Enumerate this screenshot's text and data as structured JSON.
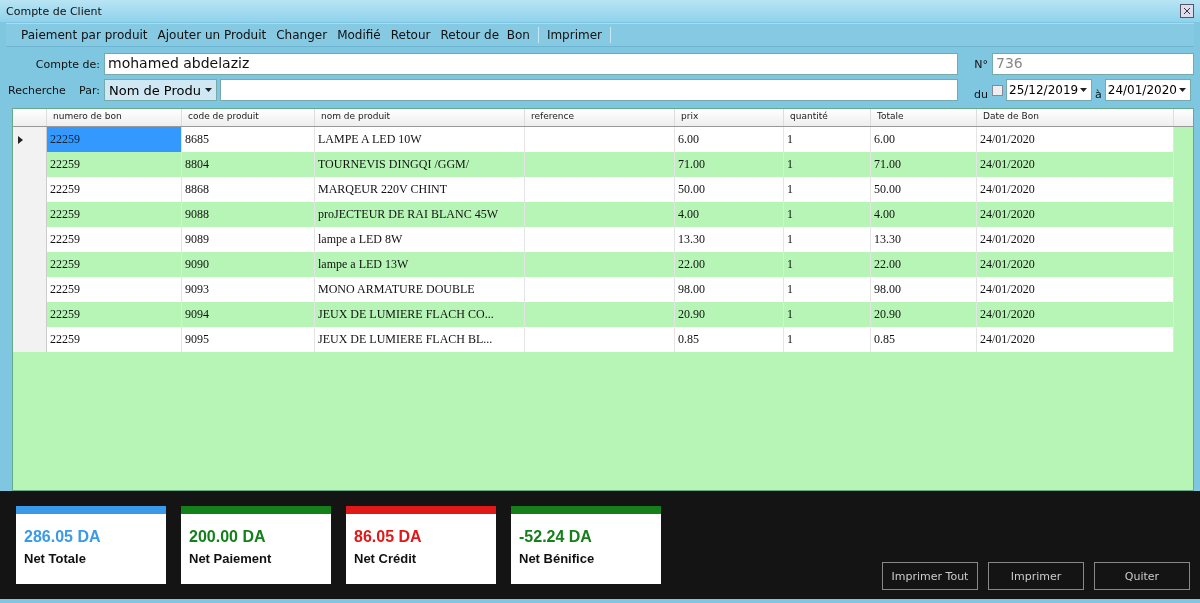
{
  "window": {
    "title": "Compte de Client"
  },
  "toolbar": {
    "items": [
      {
        "kind": "button",
        "label": "Paiement par produit"
      },
      {
        "kind": "button",
        "label": "Ajouter un Produit"
      },
      {
        "kind": "button",
        "label": "Changer"
      },
      {
        "kind": "button",
        "label": "Modifié"
      },
      {
        "kind": "button",
        "label": "Retour"
      },
      {
        "kind": "button",
        "label": "Retour de  Bon"
      },
      {
        "kind": "separator"
      },
      {
        "kind": "button",
        "label": "Imprimer"
      },
      {
        "kind": "separator"
      }
    ]
  },
  "form": {
    "compte_label": "Compte de:",
    "compte_value": "mohamed abdelaziz",
    "no_label": "N°",
    "no_value": "736",
    "recherche_label": "Recherche",
    "par_label": "Par:",
    "par_value": "Nom de Produ",
    "du_label": "du",
    "du_checked": false,
    "du_value": "25/12/2019",
    "a_label": "à",
    "a_value": "24/01/2020"
  },
  "table": {
    "columns": [
      "numero de bon",
      "code de produit",
      "nom de produit",
      "reference",
      "prix",
      "quantité",
      "Totale",
      "Date de Bon"
    ],
    "rows": [
      {
        "selected": true,
        "cells": [
          "22259",
          "8685",
          "LAMPE A LED 10W",
          "",
          "6.00",
          "1",
          "6.00",
          "24/01/2020"
        ]
      },
      {
        "selected": false,
        "cells": [
          "22259",
          "8804",
          "TOURNEVIS DINGQI /GGM/",
          "",
          "71.00",
          "1",
          "71.00",
          "24/01/2020"
        ]
      },
      {
        "selected": false,
        "cells": [
          "22259",
          "8868",
          "MARQEUR 220V CHINT",
          "",
          "50.00",
          "1",
          "50.00",
          "24/01/2020"
        ]
      },
      {
        "selected": false,
        "cells": [
          "22259",
          "9088",
          "proJECTEUR DE RAI BLANC 45W",
          "",
          "4.00",
          "1",
          "4.00",
          "24/01/2020"
        ]
      },
      {
        "selected": false,
        "cells": [
          "22259",
          "9089",
          "lampe a LED 8W",
          "",
          "13.30",
          "1",
          "13.30",
          "24/01/2020"
        ]
      },
      {
        "selected": false,
        "cells": [
          "22259",
          "9090",
          "lampe a LED 13W",
          "",
          "22.00",
          "1",
          "22.00",
          "24/01/2020"
        ]
      },
      {
        "selected": false,
        "cells": [
          "22259",
          "9093",
          "MONO ARMATURE DOUBLE",
          "",
          "98.00",
          "1",
          "98.00",
          "24/01/2020"
        ]
      },
      {
        "selected": false,
        "cells": [
          "22259",
          "9094",
          "JEUX DE LUMIERE FLACH CO...",
          "",
          "20.90",
          "1",
          "20.90",
          "24/01/2020"
        ]
      },
      {
        "selected": false,
        "cells": [
          "22259",
          "9095",
          "JEUX DE LUMIERE FLACH BL...",
          "",
          "0.85",
          "1",
          "0.85",
          "24/01/2020"
        ]
      }
    ]
  },
  "summary_cards": [
    {
      "value": "286.05 DA",
      "label": "Net Totale",
      "color": "#3a9ae8"
    },
    {
      "value": "200.00 DA",
      "label": "Net Paiement",
      "color": "#13801a"
    },
    {
      "value": "86.05 DA",
      "label": "Net Crédit",
      "color": "#e01818"
    },
    {
      "value": "-52.24 DA",
      "label": "Net Bénifice",
      "color": "#15801a"
    }
  ],
  "buttons": [
    "Imprimer Tout",
    "Imprimer",
    "Quiter"
  ]
}
